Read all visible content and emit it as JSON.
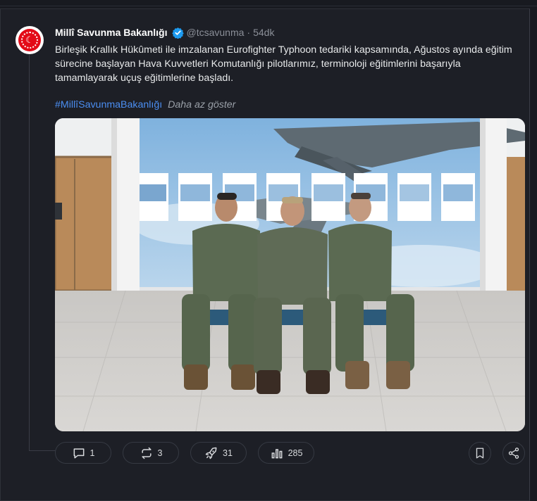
{
  "post": {
    "author_name": "Millî Savunma Bakanlığı",
    "handle": "@tcsavunma",
    "separator": "·",
    "time": "54dk",
    "text": "Birleşik Krallık Hükûmeti ile imzalanan Eurofighter Typhoon tedariki kapsamında, Ağustos ayında eğitim sürecine başlayan Hava Kuvvetleri Komutanlığı pilotlarımız, terminoloji eğitimlerini başarıyla tamamlayarak uçuş eğitimlerine başladı.",
    "hashtag": "#MillîSavunmaBakanlığı",
    "show_less": "Daha az göster"
  },
  "actions": {
    "replies": "1",
    "reposts": "3",
    "boosts": "31",
    "views": "285"
  },
  "colors": {
    "accent": "#4b8ef1",
    "avatar_red": "#e30a17",
    "verified": "#1d9bf0"
  },
  "icons": [
    "verified-badge-icon",
    "reply-icon",
    "repost-icon",
    "rocket-icon",
    "views-icon",
    "bookmark-icon",
    "share-icon"
  ]
}
